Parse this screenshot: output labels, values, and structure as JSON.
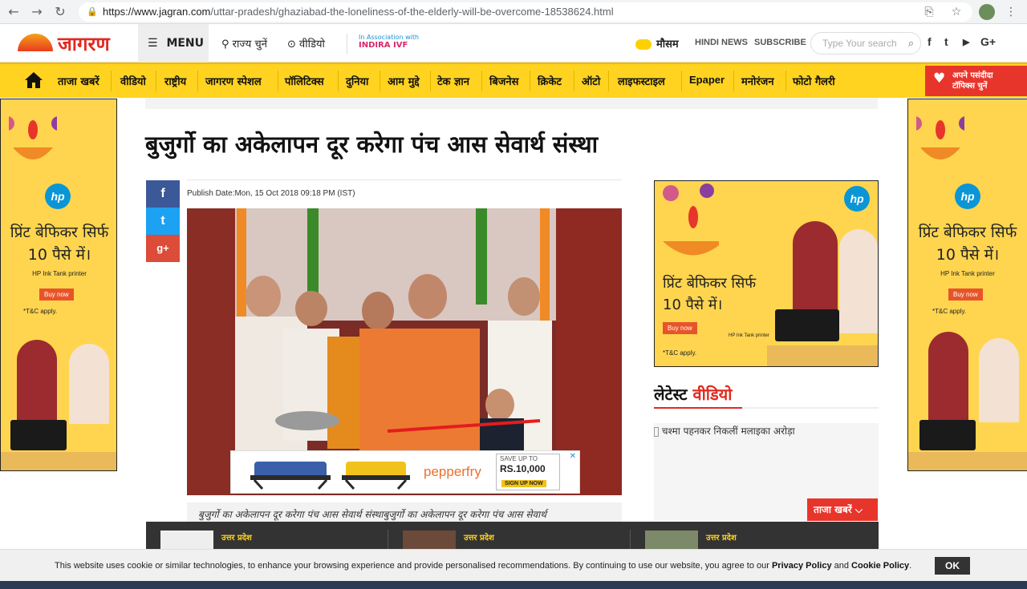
{
  "browser": {
    "url_host": "https://www.jagran.com",
    "url_path": "/uttar-pradesh/ghaziabad-the-loneliness-of-the-elderly-will-be-overcome-18538624.html",
    "back_icon": "←",
    "forward_icon": "→",
    "reload_icon": "↻",
    "lock_icon": "🔒",
    "translate_icon": "⎘",
    "star_icon": "☆",
    "more_icon": "⋮"
  },
  "header": {
    "logo_text": "जागरण",
    "menu_label": "MENU",
    "state_label": "राज्य चुनें",
    "video_label": "वीडियो",
    "assoc_line1": "In Association with",
    "assoc_line2": "INDIRA IVF",
    "weather_label": "मौसम",
    "hindi_news": "HINDI NEWS",
    "subscribe": "SUBSCRIBE",
    "search_placeholder": "Type Your search",
    "search_icon": "⌕",
    "social": [
      "f",
      "t",
      "▶",
      "G+"
    ]
  },
  "categories": [
    "ताजा खबरें",
    "वीडियो",
    "राष्ट्रीय",
    "जागरण स्पेशल",
    "पॉलिटिक्स",
    "दुनिया",
    "आम मुद्दे",
    "टेक ज्ञान",
    "बिजनेस",
    "क्रिकेट",
    "ऑटो",
    "लाइफस्टाइल",
    "Epaper",
    "मनोरंजन",
    "फोटो गैलरी"
  ],
  "favorite_topics": {
    "line1": "अपने पसंदीदा",
    "line2": "टॉपिक्स चुनें",
    "icon": "♥"
  },
  "side_ad": {
    "brand": "hp",
    "line1": "प्रिंट बेफिकर सिर्फ",
    "line2": "10 पैसे में।",
    "product": "HP Ink Tank printer",
    "buy": "Buy now",
    "tc": "*T&C apply."
  },
  "article": {
    "headline": "बुजुर्गो का अकेलापन दूर करेगा पंच आस सेवार्थ संस्था",
    "publish_date": "Publish Date:Mon, 15 Oct 2018 09:18 PM (IST)",
    "share": {
      "facebook": "f",
      "twitter": "t",
      "googleplus": "g+"
    },
    "caption": "बुजुर्गो का अकेलापन दूर करेगा पंच आस सेवार्थ संस्थाबुजुर्गो का अकेलापन दूर करेगा पंच आस सेवार्थ"
  },
  "pepperfry_ad": {
    "brand": "pepperfry",
    "save_up_to": "SAVE UP TO",
    "amount": "RS.10,000",
    "cta": "SIGN UP NOW",
    "close": "✕"
  },
  "latest_video": {
    "title_part1": "लेटेस्ट ",
    "title_part2": "वीडियो",
    "video_alt": "चश्मा पहनकर निकलीं मलाइका अरोड़ा",
    "taaza_label": "ताजा खबरें",
    "taaza_icon": "⌵"
  },
  "bottom_strip": {
    "items": [
      {
        "category": "उत्तर प्रदेश"
      },
      {
        "category": "उत्तर प्रदेश"
      },
      {
        "category": "उत्तर प्रदेश"
      }
    ]
  },
  "cookie": {
    "text_before": "This website uses cookie or similar technologies, to enhance your browsing experience and provide personalised recommendations. By continuing to use our website, you agree to our ",
    "privacy": "Privacy Policy",
    "and": " and ",
    "cookie_policy": "Cookie Policy",
    "period": ".",
    "ok": "OK"
  }
}
